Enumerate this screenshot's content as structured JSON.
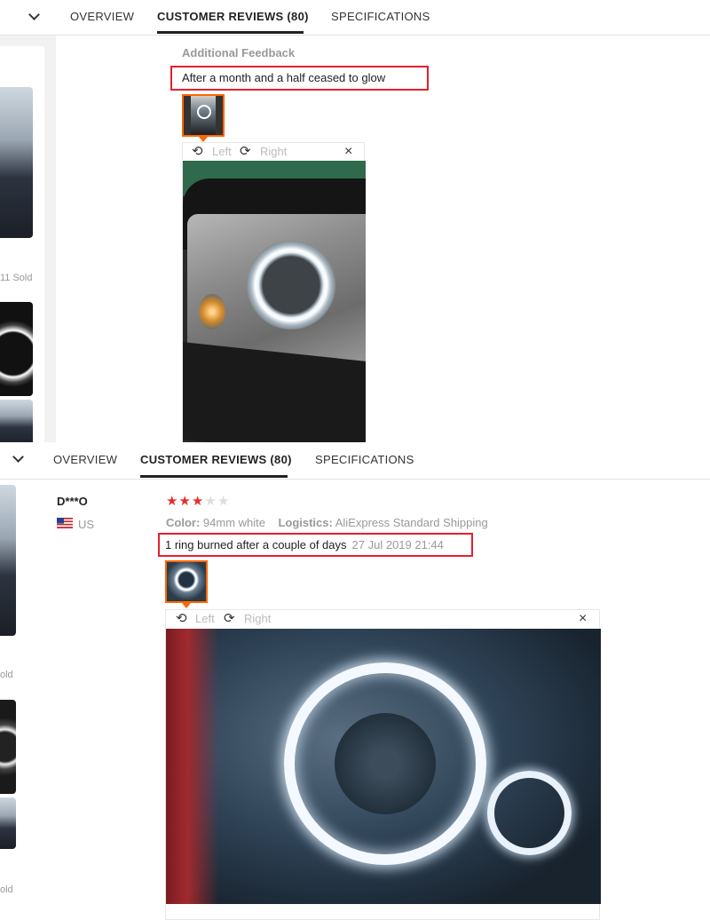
{
  "tabs": {
    "overview": "OVERVIEW",
    "reviews": "CUSTOMER REVIEWS (80)",
    "specs": "SPECIFICATIONS"
  },
  "left_strip": {
    "sold_1": "11 Sold",
    "sold_2": "old",
    "sold_3": "old"
  },
  "review1": {
    "section_label": "Additional Feedback",
    "text": "After a month and a half ceased to glow",
    "viewer": {
      "left": "Left",
      "right": "Right",
      "close": "×"
    }
  },
  "review2": {
    "user": "D***O",
    "country": "US",
    "rating": 3,
    "rating_max": 5,
    "color_label": "Color:",
    "color_value": "94mm white",
    "logistics_label": "Logistics:",
    "logistics_value": "AliExpress Standard Shipping",
    "text": "1 ring burned after a couple of days",
    "date": "27 Jul 2019 21:44",
    "viewer": {
      "left": "Left",
      "right": "Right",
      "close": "×"
    }
  },
  "colors": {
    "accent_orange": "#ff6600",
    "highlight_red": "#e3202e",
    "star_red": "#e62e2e"
  },
  "icons": [
    "chevron-down-icon",
    "rotate-left-icon",
    "rotate-right-icon",
    "close-icon",
    "star-icon",
    "us-flag-icon"
  ]
}
